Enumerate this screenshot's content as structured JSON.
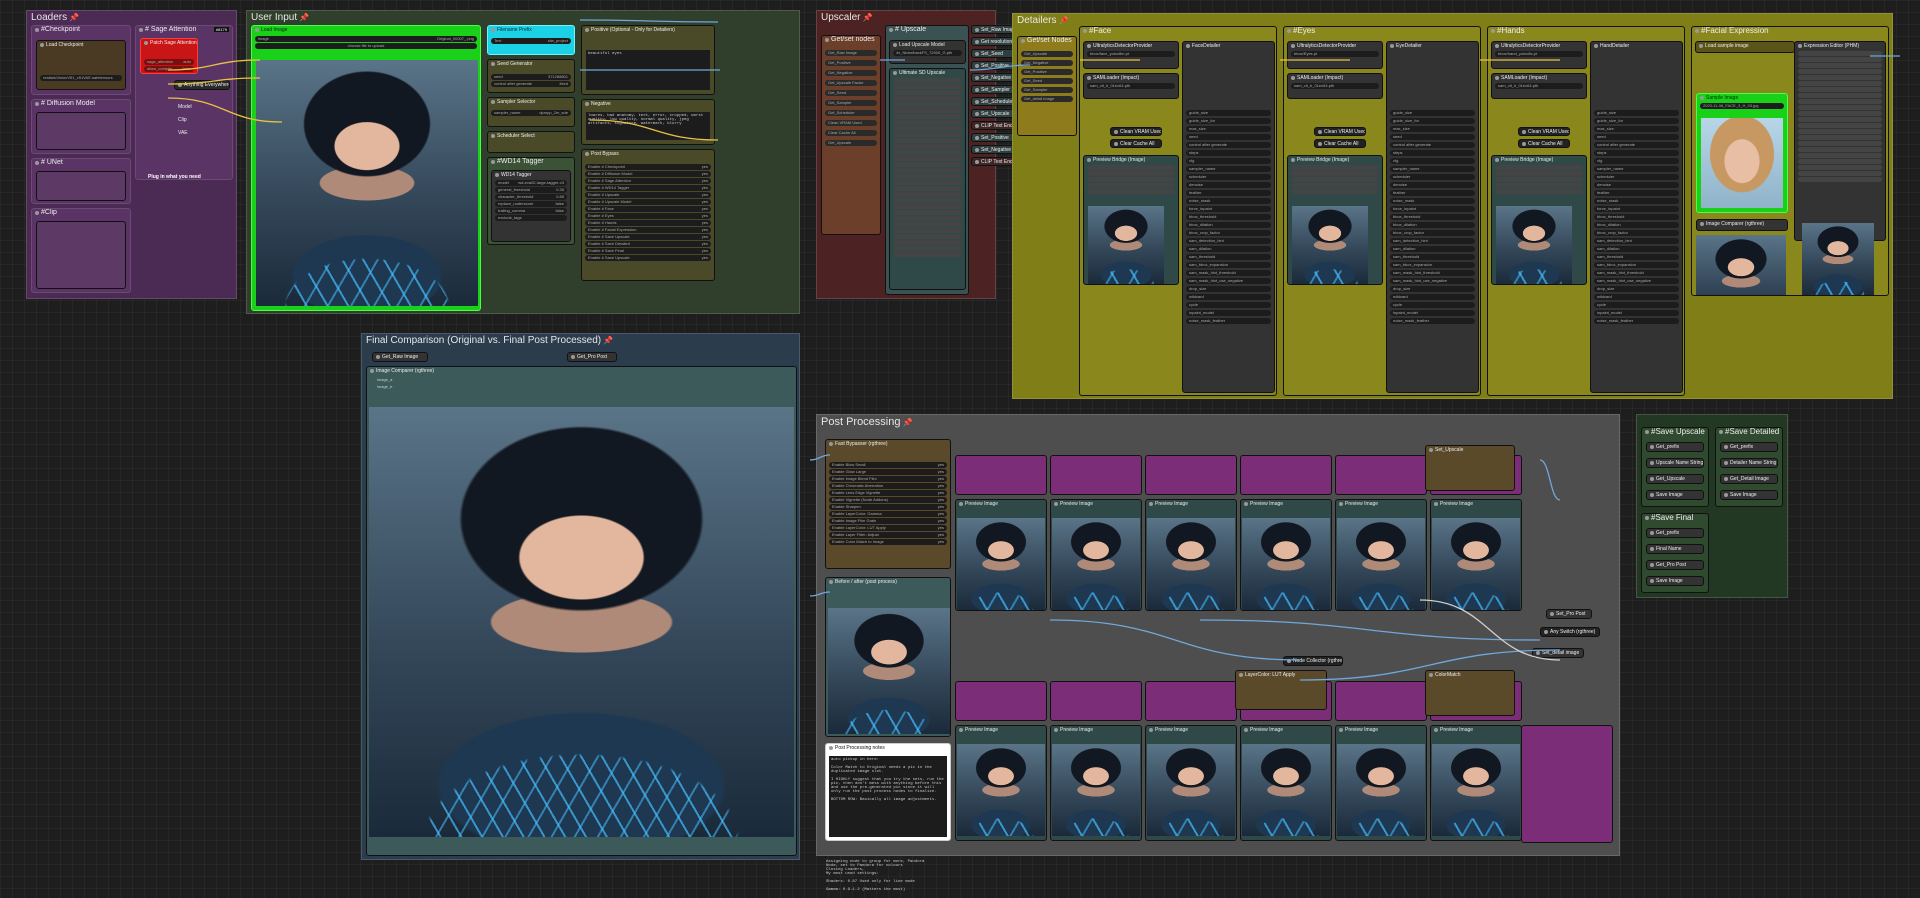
{
  "groups": {
    "loaders": {
      "title": "Loaders"
    },
    "user_input": {
      "title": "User Input"
    },
    "upscaler": {
      "title": "Upscaler"
    },
    "detailers": {
      "title": "Detailers"
    },
    "final_comparison": {
      "title": "Final Comparison (Original vs. Final Post Processed)"
    },
    "post_processing": {
      "title": "Post Processing"
    }
  },
  "loaders": {
    "checkpoint": {
      "title": "#Checkpoint",
      "node": "Load Checkpoint",
      "model": "realisticVisionV51_v51VAE.safetensors"
    },
    "diffusion": {
      "title": "# Diffusion Model"
    },
    "unet": {
      "title": "# UNet"
    },
    "clip": {
      "title": "#Clip"
    },
    "sage": {
      "title": "# Sage Attention",
      "badge": "#8179",
      "node": "Patch Sage Attention KJ",
      "rows": [
        "sage_attention",
        "allow_compile"
      ],
      "anything": "Anything Everywhere",
      "labels": [
        "Model",
        "Clip",
        "VAE",
        "Plug in what you need"
      ]
    }
  },
  "user_input": {
    "load_image": {
      "title": "Load Image",
      "file": "Original_00007_.png",
      "upload": "choose file to upload"
    },
    "filename": {
      "title": "Filename Prefix",
      "value": "Text",
      "text": "sfw_project"
    },
    "seed": {
      "title": "Seed Generator",
      "seed_label": "seed",
      "seed_value": "371288801",
      "control": "control after generate",
      "control_value": "fixed"
    },
    "sampler": {
      "title": "Sampler Selector",
      "sampler_name": "sampler_name",
      "sampler_value": "dpmpp_2m_sde",
      "scheduler": "Scheduler Select"
    },
    "wd14": {
      "title": "#WD14 Tagger",
      "node": "WD14 Tagger",
      "model": "wd-eva02-large-tagger-v3",
      "rows": [
        "general_threshold",
        "character_threshold",
        "replace_underscore",
        "trailing_comma",
        "exclude_tags"
      ]
    },
    "positive": {
      "title": "Positive (Optional - Only for Detailers)",
      "text": "beautiful eyes"
    },
    "negative": {
      "title": "Negative",
      "text": "lowres, bad anatomy, text, error, cropped, worst quality, low quality, normal quality, jpeg artifacts, signature, watermark, blurry"
    },
    "switches": {
      "title": "Post Bypass",
      "items": [
        "Enable # Checkpoint",
        "Enable # Diffusion Model",
        "Enable # Sage Attention",
        "Enable # WD14 Tagger",
        "Enable # Upscale",
        "Enable # Upscale Model",
        "Enable # Face",
        "Enable # Eyes",
        "Enable # Hands",
        "Enable # Facial Expression",
        "Enable # Save Upscale",
        "Enable # Save Detailed",
        "Enable # Save Final",
        "Enable # Save Upscale"
      ]
    }
  },
  "upscaler": {
    "get_nodes": {
      "title": "Get/set nodes",
      "items": [
        "Get_Raw Image",
        "Get_Positive",
        "Get_Negative",
        "Get_Upscale Factor",
        "Get_Seed",
        "Get_Sampler",
        "Get_Scheduler",
        "Clean VRAM Used",
        "Clear Cache All",
        "Get_Upscale"
      ]
    },
    "upscale": {
      "title": "# Upscale",
      "model_node": "Load Upscale Model",
      "model": "4x_NickelbackFS_72000_G.pth",
      "ultimate": "Ultimate SD Upscale"
    },
    "right_items": [
      "Set_Raw Image",
      "Get resolution",
      "Set_Seed",
      "Set_Positive",
      "Set_Negative",
      "Set_Sampler",
      "Set_Scheduler",
      "Set_Upscale",
      "CLIP Text Encode",
      "Set_Positive",
      "Set_Negative",
      "CLIP Text Encode"
    ]
  },
  "detailers": {
    "get_nodes": {
      "title": "Get/set Nodes",
      "items": [
        "Get_Upscale",
        "Get_Negative",
        "Get_Positive",
        "Get_Seed",
        "Get_Sampler",
        "Get_detail image"
      ]
    },
    "face": {
      "title": "#Face",
      "provider": "UltralyticsDetectorProvider",
      "model": "bbox/face_yolov8m.pt",
      "loader": "SAMLoader (Impact)",
      "sam": "sam_vit_b_01ec64.pth",
      "detailer": "FaceDetailer",
      "preview": "Preview Bridge (Image)"
    },
    "eyes": {
      "title": "#Eyes",
      "provider": "UltralyticsDetectorProvider",
      "model": "bbox/Eyes.pt",
      "loader": "SAMLoader (Impact)",
      "sam": "sam_vit_b_01ec64.pth",
      "detailer": "EyeDetailer",
      "preview": "Preview Bridge (Image)"
    },
    "hands": {
      "title": "#Hands",
      "provider": "UltralyticsDetectorProvider",
      "model": "bbox/hand_yolov8s.pt",
      "loader": "SAMLoader (Impact)",
      "sam": "sam_vit_b_01ec64.pth",
      "detailer": "HandDetailer",
      "preview": "Preview Bridge (Image)"
    },
    "expression": {
      "title": "#Facial Expression",
      "loader": "Load sample image",
      "editor": "Expression Editor (PHM)",
      "sample": "Sample Image",
      "file": "2023-11-06_FACE_3_H_03.jpg",
      "compare": "Image Comparer (rgthree)"
    },
    "clear": [
      "Clean VRAM Used",
      "Clear Cache All"
    ],
    "params": [
      "guide_size",
      "guide_size_for",
      "max_size",
      "seed",
      "control after generate",
      "steps",
      "cfg",
      "sampler_name",
      "scheduler",
      "denoise",
      "feather",
      "noise_mask",
      "force_inpaint",
      "bbox_threshold",
      "bbox_dilation",
      "bbox_crop_factor",
      "sam_detection_hint",
      "sam_dilation",
      "sam_threshold",
      "sam_bbox_expansion",
      "sam_mask_hint_threshold",
      "sam_mask_hint_use_negative",
      "drop_size",
      "wildcard",
      "cycle",
      "inpaint_model",
      "noise_mask_feather"
    ]
  },
  "final_comparison": {
    "get_nodes": [
      "Get_Raw Image",
      "Get_Pro Post"
    ],
    "node": "Image Comparer (rgthree)",
    "slots": [
      "image_a",
      "image_b"
    ]
  },
  "post_processing": {
    "bypasser": {
      "title": "Fast Bypasser (rgthree)",
      "items": [
        "Enable Blow Small",
        "Enable Glow Large",
        "Enable Image Blend Film",
        "Enable Chromatic Aberration",
        "Enable Lens Edge Vignette",
        "Enable Vignette (Node Addons)",
        "Enable Sharpen",
        "Enable LayerColor: Gamma",
        "Enable Image Film Grain",
        "Enable LayerColor: LUT Apply",
        "Enable Layer Filter: Adjust",
        "Enable Color Match to Image"
      ]
    },
    "before_after": "Before / after (post process)",
    "notes": {
      "title": "Post Processing notes",
      "lines": [
        "auto pickup in here:",
        "Color Match to Original needs a pic in the duplicated image slot.",
        "I HIGHLY suggest that you try the sets, run the pic, then don't mess with anything before this and use the pre-generated pic since it will only run the post process nodes to finalize.",
        "BOTTOM ROW: Basically all image adjustments.",
        "Each image was set at max output"
      ]
    },
    "preview_label": "Preview Image",
    "layer_label": "LayerColor: LUT Apply",
    "color_label": "ColorMatch",
    "switch": "Any Switch (rgthree)",
    "node_collector": "Node Collector (rgthree)",
    "set_post": "Set_Pro Post",
    "set_detail": "Set_detail image",
    "set_upscale": "Set_Upscale"
  },
  "saves": {
    "upscale": {
      "title": "#Save Upscale",
      "items": [
        "Get_prefix",
        "Upscale Name String",
        "Get_Upscale",
        "Save Image"
      ]
    },
    "detailed": {
      "title": "#Save Detailed",
      "items": [
        "Get_prefix",
        "Detailer Name String",
        "Get_Detail Image",
        "Save Image"
      ]
    },
    "final": {
      "title": "#Save Final",
      "items": [
        "Get_prefix",
        "Final Name",
        "Get_Pro Post",
        "Save Image"
      ]
    }
  },
  "bottom_text": [
    "Assigning node to group for more, Pandora",
    "Node, set to Pandora for colours",
    "Closing Loaders,",
    "My most used settings:",
    "Shaders: 0.87 Used only for line mode",
    "Gamma: 0.9-1.2 (Matters the most)"
  ],
  "colors": {
    "loaders_bg": "#4b2a53",
    "user_input_bg": "#2f3f2c",
    "upscaler_bg": "#4c2222",
    "detailers_bg": "#7f7e17",
    "final_bg": "#2b3c4d",
    "post_bg": "#4e4e4e",
    "save_bg": "#233823",
    "green": "#19d119",
    "cyan": "#1bd1e6",
    "red": "#e01a1a",
    "wire_blue": "#6fa8dc",
    "wire_yellow": "#e8c246",
    "magenta": "#7b2d78"
  }
}
